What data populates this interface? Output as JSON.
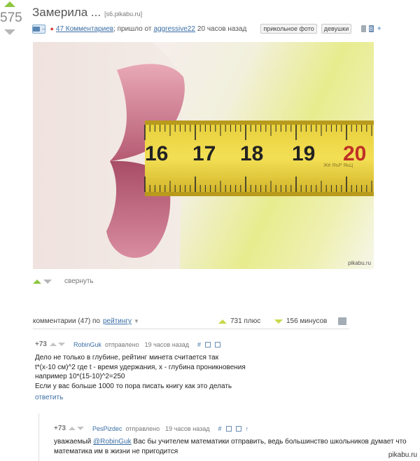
{
  "post": {
    "rating": "575",
    "title": "Замерила ...",
    "source": "[s6.pikabu.ru]",
    "save_label": "–",
    "comments_link": "47 Комментариев",
    "posted_text": "; пришло от",
    "author": "aggressive22",
    "time_ago": "20 часов назад",
    "tags": [
      "прикольное фото",
      "девушки"
    ],
    "share_icons": [
      "save-icon",
      "vk-icon",
      "twitter-icon"
    ],
    "image": {
      "ruler_numbers": [
        "16",
        "17",
        "18",
        "19",
        "20"
      ],
      "ruler_brand": "Жё ЯъР ЯьЦ",
      "watermark": "pikabu.ru"
    },
    "collapse_label": "свернуть"
  },
  "comments_header": {
    "label": "комментарии (47) по",
    "sort": "рейтингу",
    "plus": "731 плюс",
    "minus": "156 минусов"
  },
  "comments": [
    {
      "rating": "+73",
      "author": "RobinGuk",
      "sent": "отправлено",
      "time": "19 часов назад",
      "lines": [
        "Дело не только в глубине, рейтинг минета считается так",
        "t*(x-10 см)^2 где t - время удержания, x - глубина проникновения",
        "например 10*(15-10)^2=250",
        "Если у вас больше 1000 то пора писать книгу как это делать"
      ],
      "reply": "ответить"
    },
    {
      "rating": "+73",
      "author": "PesPizdec",
      "sent": "отправлено",
      "time": "19 часов назад",
      "mention": "@RobinGuk",
      "line1_prefix": "уважаемый",
      "line1_suffix": "Вас бы учителем математики отправить, ведь большинство школьников думает что",
      "line2": "математика им в жизни не пригодится"
    }
  ],
  "site_tag": "pikabu.ru",
  "colors": {
    "up_arrow": "#8dc63f",
    "down_arrow": "#b7b7b7",
    "link": "#3b6ea5"
  }
}
